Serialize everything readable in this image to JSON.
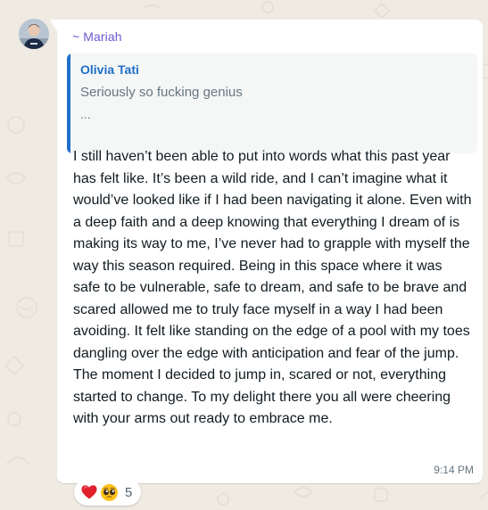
{
  "message": {
    "sender": "~ Mariah",
    "quoted": {
      "author": "Olivia Tati",
      "text": "Seriously so fucking genius",
      "ellipsis": "..."
    },
    "body": "I still haven’t been able to put into words what this past year has felt like. It’s been a wild ride, and I can’t imagine what it would’ve looked like if I had been navigating it alone. Even with a deep faith and a deep knowing that everything I dream of is making its way to me, I’ve never had to grapple with myself the way this season required. Being in this space where it was safe to be vulnerable, safe to dream, and safe to be brave and scared allowed me to truly face myself in a way I had been avoiding. It felt like standing on the edge of a pool with my toes dangling over the edge with anticipation and fear of the jump. The moment I decided to jump in, scared or not, everything started to change. To my delight there you all were cheering with your arms out ready to embrace me.",
    "time": "9:14 PM"
  },
  "reactions": {
    "icons": [
      "red-heart-icon",
      "pleading-face-icon"
    ],
    "count": "5"
  },
  "colors": {
    "chat_background": "#efeae2",
    "bubble": "#ffffff",
    "sender_name": "#6a5bd1",
    "quote_accent": "#1f6fc9",
    "secondary_text": "#667781",
    "primary_text": "#111b21"
  }
}
